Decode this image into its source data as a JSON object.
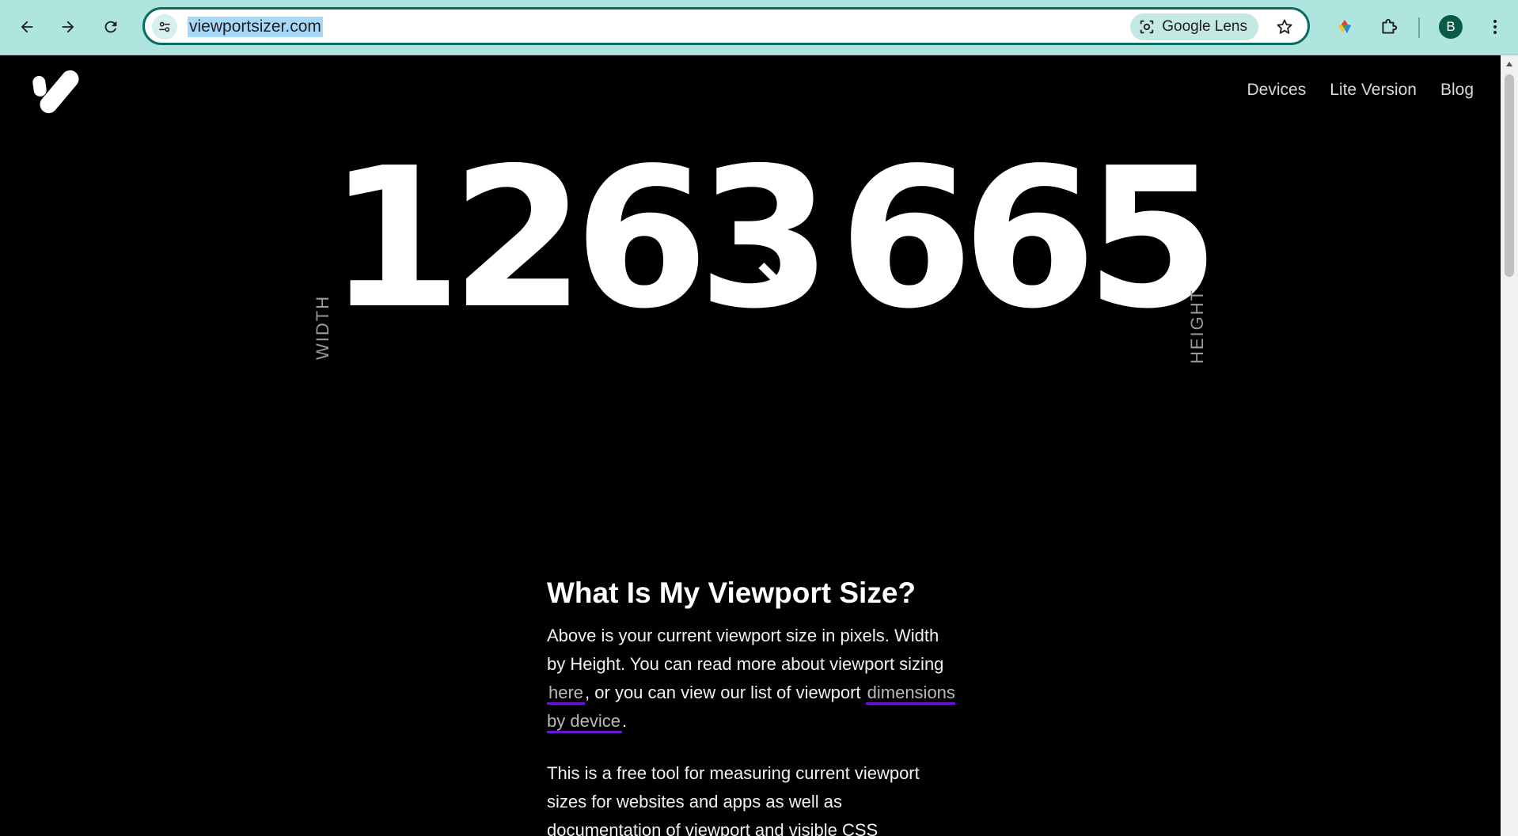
{
  "browser": {
    "url": "viewportsizer.com",
    "lens_label": "Google Lens",
    "profile_initial": "B"
  },
  "site": {
    "nav": [
      "Devices",
      "Lite Version",
      "Blog"
    ]
  },
  "viewport": {
    "width": "1263",
    "height": "665",
    "times": "×",
    "width_label": "WIDTH",
    "height_label": "HEIGHT"
  },
  "article": {
    "heading": "What Is My Viewport Size?",
    "p1_text_a": "Above is your current viewport size in pixels. Width by Height. You can read more about viewport sizing ",
    "p1_link_1": "here",
    "p1_text_b": ", or you can view our list of viewport ",
    "p1_link_2": "dimensions by device",
    "p1_text_c": ".",
    "p2": "This is a free tool for measuring current viewport sizes for websites and apps as well as documentation of viewport and visible CSS"
  },
  "colors": {
    "chrome_bg": "#aee5df",
    "omnibox_border": "#0b6b63",
    "link_underline": "#6a14d9",
    "avatar_bg": "#0b5a45"
  },
  "icons": [
    "back-arrow-icon",
    "forward-arrow-icon",
    "reload-icon",
    "tune-icon",
    "lens-icon",
    "star-icon",
    "color-extension-icon",
    "puzzle-icon",
    "kebab-menu-icon",
    "site-logo-icon"
  ]
}
